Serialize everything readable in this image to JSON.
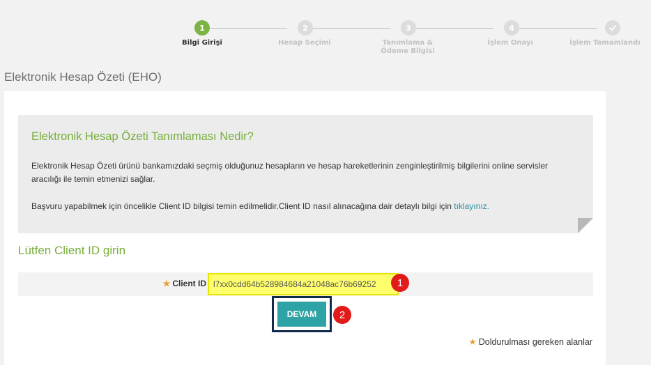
{
  "stepper": {
    "steps": [
      {
        "number": "1",
        "label": "Bilgi Girişi",
        "active": true
      },
      {
        "number": "2",
        "label": "Hesap Seçimi",
        "active": false
      },
      {
        "number": "3",
        "label": "Tanımlama & Ödeme Bilgisi",
        "active": false
      },
      {
        "number": "4",
        "label": "İşlem Onayı",
        "active": false
      },
      {
        "number": "",
        "icon": "check-icon",
        "label": "İşlem Tamamlandı",
        "active": false
      }
    ]
  },
  "page": {
    "title": "Elektronik Hesap Özeti (EHO)"
  },
  "info": {
    "title": "Elektronik Hesap Özeti Tanımlaması Nedir?",
    "paragraph1": "Elektronik Hesap Özeti ürünü bankamızdaki seçmiş olduğunuz hesapların ve hesap hareketlerinin zenginleştirilmiş bilgilerini online servisler aracılığı ile temin etmenizi sağlar.",
    "paragraph2": "Başvuru yapabilmek için öncelikle Client ID bilgisi temin edilmelidir.Client ID nasıl alınacağına dair detaylı bilgi için",
    "link": "tıklayınız."
  },
  "form": {
    "section_title": "Lütfen Client ID girin",
    "star": "★",
    "client_id_label": "Client ID",
    "client_id_value": "l7xx0cdd64b528984684a21048ac76b69252",
    "submit_label": "DEVAM",
    "required_note": "Doldurulması gereken alanlar"
  },
  "annotations": {
    "marker1": "1",
    "marker2": "2"
  },
  "colors": {
    "accent_green": "#7cb441",
    "teal_button": "#2da3a5",
    "highlight_yellow": "#ffff6d",
    "marker_red": "#e21a1a",
    "frame_navy": "#0f2a4d"
  }
}
